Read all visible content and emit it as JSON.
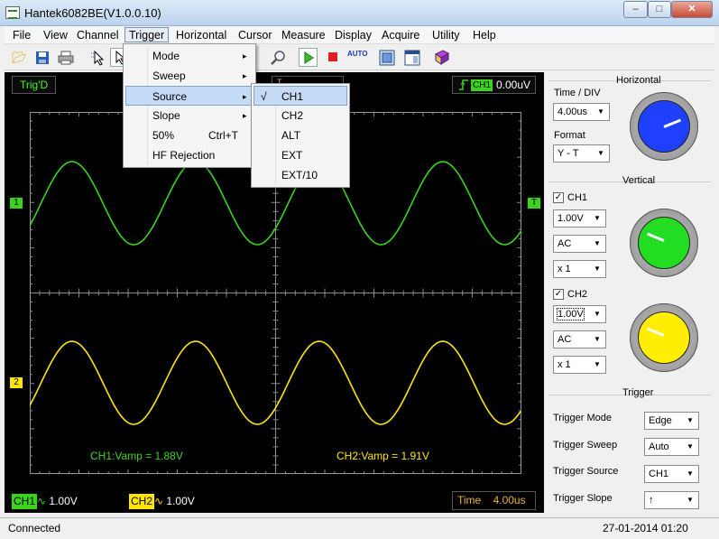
{
  "window": {
    "title": "Hantek6082BE(V1.0.0.10)",
    "min_label": "‒",
    "max_label": "□",
    "close_label": "✕"
  },
  "menubar": [
    "File",
    "View",
    "Channel",
    "Trigger",
    "Horizontal",
    "Cursor",
    "Measure",
    "Display",
    "Acquire",
    "Utility",
    "Help"
  ],
  "toolbar": {
    "icons": [
      "open-icon",
      "save-icon",
      "print-icon",
      "cursor-select-icon",
      "pointer-icon",
      "zoom-icon",
      "run-icon",
      "stop-icon",
      "auto-icon",
      "fit-icon",
      "window-icon",
      "book-icon"
    ],
    "auto_label": "AUTO"
  },
  "trigger_menu": {
    "items": [
      {
        "label": "Mode",
        "submenu": true
      },
      {
        "label": "Sweep",
        "submenu": true
      },
      {
        "label": "Source",
        "submenu": true,
        "highlighted": true
      },
      {
        "label": "Slope",
        "submenu": true
      },
      {
        "label": "50%",
        "shortcut": "Ctrl+T"
      },
      {
        "label": "HF Rejection"
      }
    ],
    "arrow": "▸"
  },
  "source_submenu": {
    "items": [
      "CH1",
      "CH2",
      "ALT",
      "EXT",
      "EXT/10"
    ],
    "checked": "CH1",
    "check_mark": "√"
  },
  "scope": {
    "trig_state": "Trig'D",
    "trig_channel": "CH1",
    "trig_level": "0.00uV",
    "trig_pos_marker": "T",
    "ch1_marker": "1",
    "ch2_marker": "2",
    "trig_level_marker": "T",
    "ch1_measure": "CH1:Vamp = 1.88V",
    "ch2_measure": "CH2:Vamp = 1.91V",
    "ch1_volt": {
      "tag": "CH1",
      "symbol": "∿",
      "value": "1.00V"
    },
    "ch2_volt": {
      "tag": "CH2",
      "symbol": "∿",
      "value": "1.00V"
    },
    "time_label": "Time",
    "time_value": "4.00us",
    "colors": {
      "ch1": "#39d41c",
      "ch2": "#ffe600",
      "grid": "#6a6a6a"
    }
  },
  "side_panel": {
    "horizontal": {
      "title": "Horizontal",
      "time_div_label": "Time / DIV",
      "time_div_value": "4.00us",
      "format_label": "Format",
      "format_value": "Y - T",
      "knob_color": "#2040ff"
    },
    "vertical": {
      "title": "Vertical",
      "ch1": {
        "label": "CH1",
        "checked": true,
        "volt": "1.00V",
        "coupling": "AC",
        "probe": "x 1",
        "knob_color": "#22dd22"
      },
      "ch2": {
        "label": "CH2",
        "checked": true,
        "volt": "1.00V",
        "coupling": "AC",
        "probe": "x 1",
        "knob_color": "#ffee00"
      }
    },
    "trigger": {
      "title": "Trigger",
      "mode_label": "Trigger Mode",
      "mode_value": "Edge",
      "sweep_label": "Trigger Sweep",
      "sweep_value": "Auto",
      "source_label": "Trigger Source",
      "source_value": "CH1",
      "slope_label": "Trigger Slope",
      "slope_value": "↑"
    }
  },
  "statusbar": {
    "left": "Connected",
    "right": "27-01-2014 01:20"
  }
}
